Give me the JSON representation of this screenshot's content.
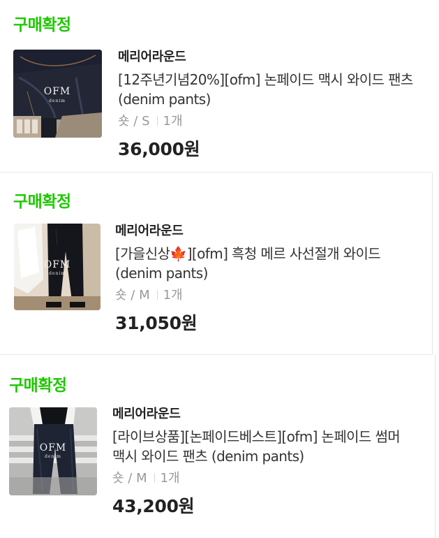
{
  "orders": [
    {
      "status": "구매확정",
      "store": "메리어라운드",
      "product_name": "[12주년기념20%][ofm] 논페이드 맥시 와이드 팬츠 (denim pants)",
      "option": "숏 / S",
      "quantity": "1개",
      "price": "36,000원",
      "thumbnail": {
        "brand_text": "OFM",
        "sub_text": "denim"
      }
    },
    {
      "status": "구매확정",
      "store": "메리어라운드",
      "product_name": "[가을신상🍁][ofm] 흑청 메르 사선절개 와이드 (denim pants)",
      "option": "숏 / M",
      "quantity": "1개",
      "price": "31,050원",
      "thumbnail": {
        "brand_text": "OFM",
        "sub_text": "denim"
      }
    },
    {
      "status": "구매확정",
      "store": "메리어라운드",
      "product_name": "[라이브상품][논페이드베스트][ofm] 논페이드 썸머 맥시 와이드 팬츠 (denim pants)",
      "option": "숏 / M",
      "quantity": "1개",
      "price": "43,200원",
      "thumbnail": {
        "brand_text": "OFM",
        "sub_text": "denim"
      }
    }
  ],
  "colors": {
    "status_green": "#1ec800",
    "text_primary": "#222222",
    "text_secondary": "#999999",
    "divider": "#e9e9e9"
  }
}
